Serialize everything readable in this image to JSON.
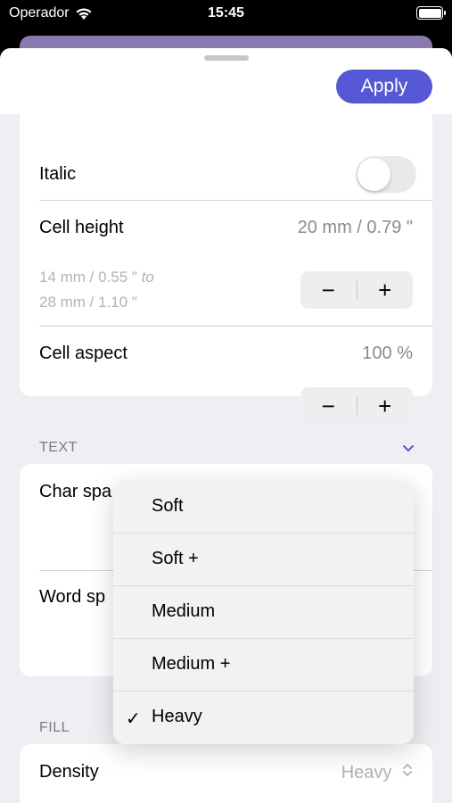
{
  "status_bar": {
    "carrier": "Operador",
    "time": "15:45"
  },
  "header": {
    "apply_label": "Apply"
  },
  "geometry_card": {
    "italic_label": "Italic",
    "italic_on": false,
    "cell_height_label": "Cell height",
    "cell_height_value": "20 mm / 0.79 \"",
    "range_from": "14 mm / 0.55 \"",
    "range_to_word": "to",
    "range_to": "28 mm / 1.10 \"",
    "cell_aspect_label": "Cell aspect",
    "cell_aspect_value": "100 %",
    "minus": "−",
    "plus": "+"
  },
  "text_section": {
    "header": "TEXT",
    "char_spacing_label": "Char spa",
    "word_spacing_label": "Word sp"
  },
  "fill_section": {
    "header": "FILL",
    "density_label": "Density",
    "density_value": "Heavy"
  },
  "menu": {
    "items": [
      {
        "label": "Soft",
        "selected": false
      },
      {
        "label": "Soft +",
        "selected": false
      },
      {
        "label": "Medium",
        "selected": false
      },
      {
        "label": "Medium +",
        "selected": false
      },
      {
        "label": "Heavy",
        "selected": true
      }
    ],
    "check_glyph": "✓"
  },
  "colors": {
    "accent": "#5557d5",
    "back_card": "#8a7ab0"
  }
}
